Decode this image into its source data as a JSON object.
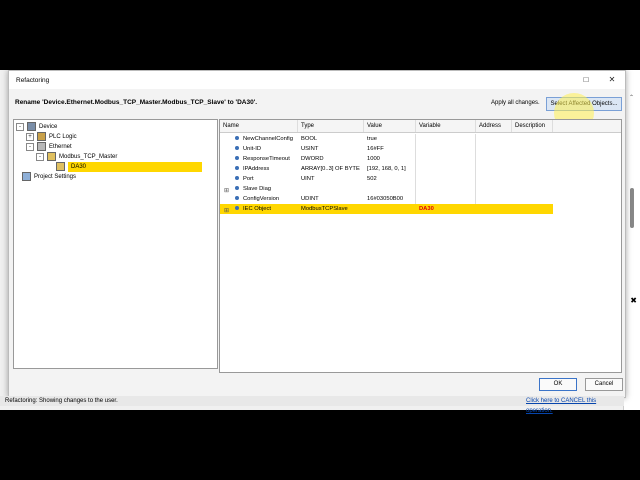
{
  "window": {
    "title": "Refactoring"
  },
  "header": {
    "rename_text": "Rename 'Device.Ethernet.Modbus_TCP_Master.Modbus_TCP_Slave' to 'DA30'.",
    "apply_text": "Apply all changes.",
    "select_button": "Select Affected Objects..."
  },
  "tree": {
    "items": [
      {
        "label": "Device",
        "expanded": true
      },
      {
        "label": "PLC Logic",
        "expanded": false
      },
      {
        "label": "Ethernet",
        "expanded": true
      },
      {
        "label": "Modbus_TCP_Master",
        "expanded": true
      },
      {
        "label": "DA30",
        "selected": true
      },
      {
        "label": "Project Settings"
      }
    ]
  },
  "grid": {
    "columns": [
      "Name",
      "Type",
      "Value",
      "Variable",
      "Address",
      "Description"
    ],
    "rows": [
      {
        "name": "NewChannelConfig",
        "type": "BOOL",
        "value": "true",
        "variable": ""
      },
      {
        "name": "Unit-ID",
        "type": "USINT",
        "value": "16#FF",
        "variable": ""
      },
      {
        "name": "ResponseTimeout",
        "type": "DWORD",
        "value": "1000",
        "variable": ""
      },
      {
        "name": "IPAddress",
        "type": "ARRAY[0..3] OF BYTE",
        "value": "[192, 168, 0, 1]",
        "variable": ""
      },
      {
        "name": "Port",
        "type": "UINT",
        "value": "502",
        "variable": ""
      },
      {
        "name": "Slave Diag",
        "type": "",
        "value": "",
        "variable": "",
        "expandable": true
      },
      {
        "name": "ConfigVersion",
        "type": "UDINT",
        "value": "16#03050B00",
        "variable": ""
      },
      {
        "name": "IEC Object",
        "type": "ModbusTCPSlave",
        "value": "",
        "variable": "DA30",
        "selected": true,
        "expandable": true
      }
    ]
  },
  "buttons": {
    "ok": "OK",
    "cancel": "Cancel"
  },
  "status": {
    "text": "Refactoring: Showing changes to the user.",
    "cancel_link": "Click here to CANCEL this operation."
  },
  "colors": {
    "selection": "#ffd700",
    "variable_highlight": "#e00000",
    "link": "#0645ad"
  }
}
